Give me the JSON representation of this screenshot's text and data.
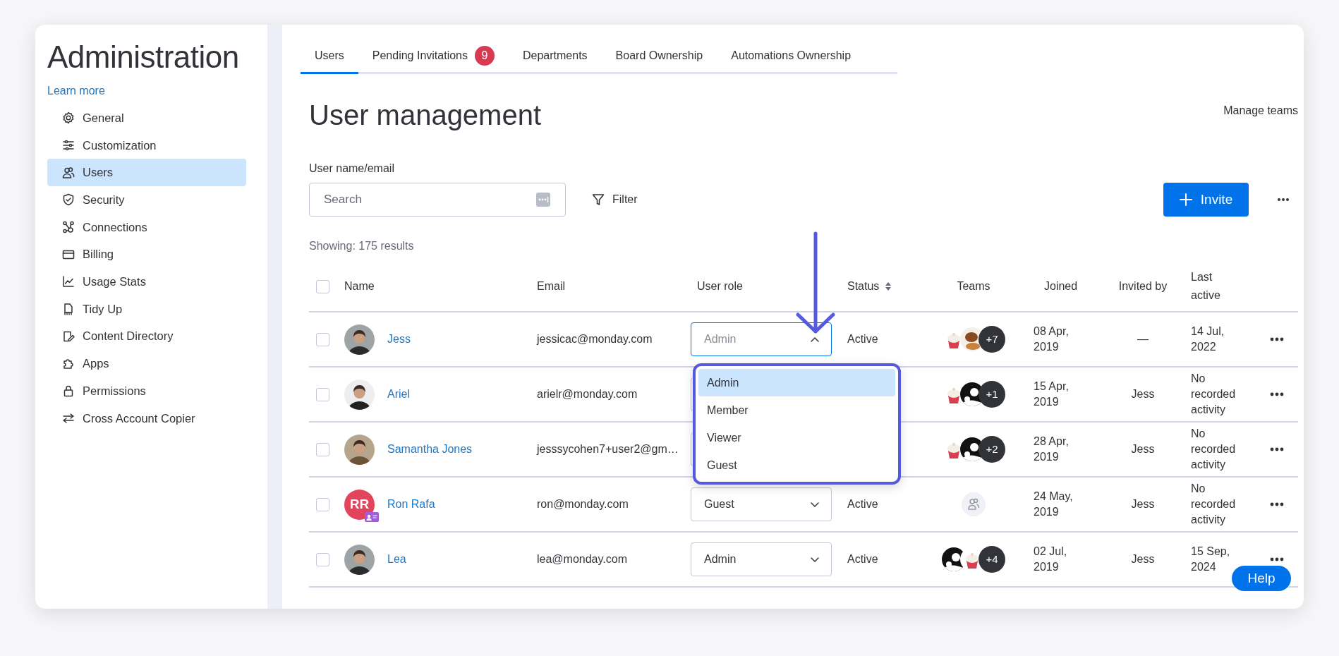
{
  "sidebar": {
    "title": "Administration",
    "link": "Learn more",
    "items": [
      {
        "label": "General",
        "selected": false
      },
      {
        "label": "Customization",
        "selected": false
      },
      {
        "label": "Users",
        "selected": true
      },
      {
        "label": "Security",
        "selected": false
      },
      {
        "label": "Connections",
        "selected": false
      },
      {
        "label": "Billing",
        "selected": false
      },
      {
        "label": "Usage Stats",
        "selected": false
      },
      {
        "label": "Tidy Up",
        "selected": false
      },
      {
        "label": "Content Directory",
        "selected": false
      },
      {
        "label": "Apps",
        "selected": false
      },
      {
        "label": "Permissions",
        "selected": false
      },
      {
        "label": "Cross Account Copier",
        "selected": false
      }
    ]
  },
  "tabs": [
    {
      "label": "Users",
      "selected": true
    },
    {
      "label": "Pending Invitations",
      "selected": false,
      "badge": "9"
    },
    {
      "label": "Departments",
      "selected": false
    },
    {
      "label": "Board Ownership",
      "selected": false
    },
    {
      "label": "Automations Ownership",
      "selected": false
    }
  ],
  "page": {
    "title": "User management",
    "manage_teams": "Manage teams",
    "search": {
      "label": "User name/email",
      "placeholder": "Search"
    },
    "filter": "Filter",
    "invite": "Invite",
    "results": "Showing: 175 results"
  },
  "table": {
    "select_all_checked": false,
    "columns": [
      {
        "label": "Name",
        "sortable": false
      },
      {
        "label": "Email",
        "sortable": false
      },
      {
        "label": "User role",
        "sortable": false
      },
      {
        "label": "Status",
        "sortable": true
      },
      {
        "label": "Teams",
        "sortable": false
      },
      {
        "label": "Joined",
        "sortable": false
      },
      {
        "label": "Invited by",
        "sortable": false
      },
      {
        "label": "Last active",
        "sortable": false
      }
    ],
    "rows": [
      {
        "checked": false,
        "name": "Jess",
        "email": "jessicac@monday.com",
        "role": {
          "value": "Admin",
          "expanded": true,
          "options": [
            {
              "label": "Admin",
              "selected": true
            },
            {
              "label": "Member",
              "selected": false
            },
            {
              "label": "Viewer",
              "selected": false
            },
            {
              "label": "Guest",
              "selected": false
            }
          ]
        },
        "status": "Active",
        "teams": {
          "kind": "avatars",
          "more": "+7"
        },
        "joined": "08 Apr, 2019",
        "invited_by": "—",
        "last_active": "14 Jul, 2022"
      },
      {
        "checked": false,
        "name": "Ariel",
        "email": "arielr@monday.com",
        "teams": {
          "kind": "avatars",
          "more": "+1"
        },
        "joined": "15 Apr, 2019",
        "invited_by": "Jess",
        "last_active": "No recorded activity"
      },
      {
        "checked": false,
        "name": "Samantha Jones",
        "email": "jesssycohen7+user2@gm…",
        "teams": {
          "kind": "avatars",
          "more": "+2"
        },
        "joined": "28 Apr, 2019",
        "invited_by": "Jess",
        "last_active": "No recorded activity"
      },
      {
        "checked": false,
        "avatar": {
          "kind": "initials",
          "initials": "RR",
          "guest_badge": true
        },
        "name": "Ron Rafa",
        "email": "ron@monday.com",
        "role": {
          "value": "Guest",
          "expanded": false
        },
        "status": "Active",
        "teams": {
          "kind": "placeholder"
        },
        "joined": "24 May, 2019",
        "invited_by": "Jess",
        "last_active": "No recorded activity"
      },
      {
        "checked": false,
        "name": "Lea",
        "email": "lea@monday.com",
        "role": {
          "value": "Admin",
          "expanded": false
        },
        "status": "Active",
        "teams": {
          "kind": "avatars",
          "more": "+4"
        },
        "joined": "02 Jul, 2019",
        "invited_by": "Jess",
        "last_active": "15 Sep, 2024"
      }
    ]
  },
  "help_button": "Help"
}
